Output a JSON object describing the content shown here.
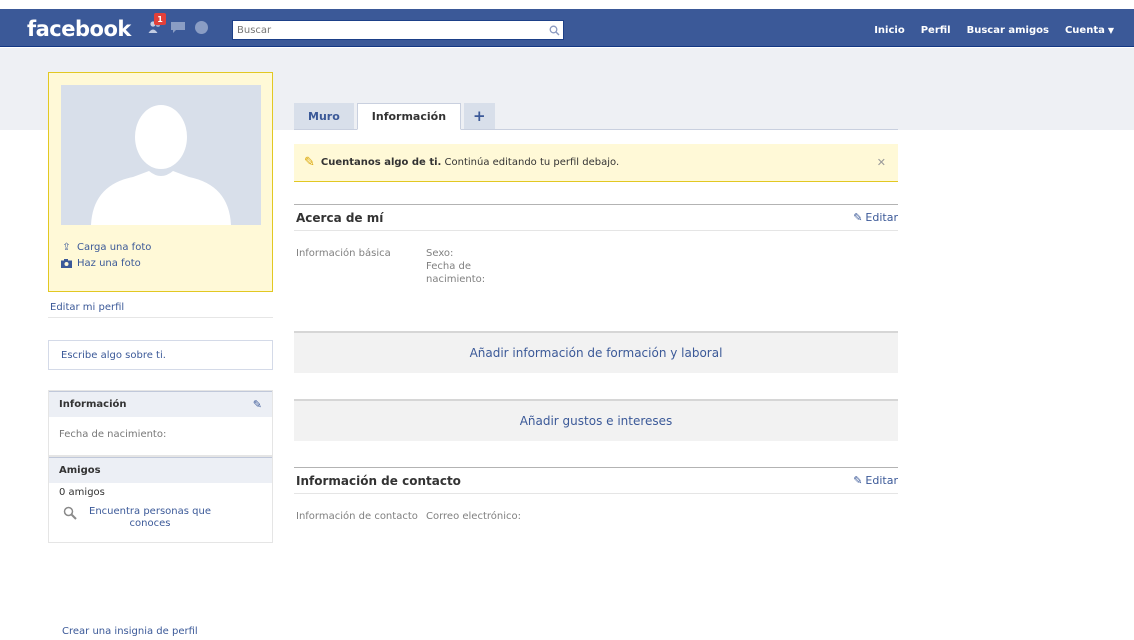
{
  "header": {
    "logo": "facebook",
    "notification_count": "1",
    "search_placeholder": "Buscar",
    "nav": [
      "Inicio",
      "Perfil",
      "Buscar amigos",
      "Cuenta"
    ]
  },
  "left": {
    "upload_photo": "Carga una foto",
    "take_photo": "Haz una foto",
    "edit_profile": "Editar mi perfil",
    "write_about": "Escribe algo sobre ti.",
    "info_title": "Información",
    "info_birthday": "Fecha de nacimiento:",
    "friends_title": "Amigos",
    "friends_count": "0 amigos",
    "find_people": "Encuentra personas que conoces",
    "create_badge": "Crear una insignia de perfil"
  },
  "tabs": [
    "Muro",
    "Información",
    "+"
  ],
  "notice": {
    "strong": "Cuentanos algo de ti.",
    "text": "Continúa editando tu perfil debajo."
  },
  "about": {
    "title": "Acerca de mí",
    "edit": "Editar",
    "label": "Información básica",
    "sex": "Sexo:",
    "birthdate": "Fecha de nacimiento:"
  },
  "add_education": "Añadir información de formación y laboral",
  "add_interests": "Añadir gustos e intereses",
  "contact": {
    "title": "Información de contacto",
    "edit": "Editar",
    "label": "Información de contacto",
    "email": "Correo electrónico:"
  },
  "colors": {
    "brand": "#3b5998",
    "notice_bg": "#fff9d7",
    "notice_border": "#e2c822"
  }
}
